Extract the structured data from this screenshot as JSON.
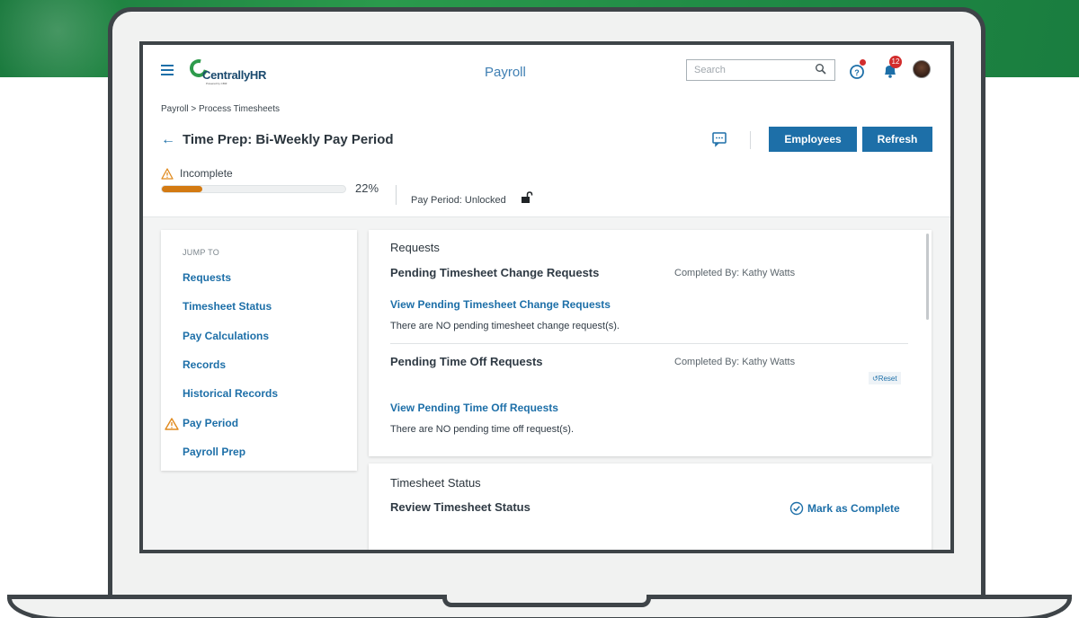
{
  "app": {
    "title": "Payroll",
    "logo_text": "CentrallyHR",
    "logo_subtext": "Powered by CBIZ"
  },
  "header": {
    "search_placeholder": "Search",
    "notification_count": "12"
  },
  "breadcrumb": "Payroll > Process Timesheets",
  "page_title": "Time Prep: Bi-Weekly Pay Period",
  "buttons": {
    "employees": "Employees",
    "refresh": "Refresh"
  },
  "status": {
    "label": "Incomplete",
    "progress_percent": 22,
    "progress_text": "22%",
    "pay_period": "Pay Period: Unlocked"
  },
  "jump_to": {
    "title": "JUMP TO",
    "items": [
      {
        "label": "Requests",
        "warning": false
      },
      {
        "label": "Timesheet Status",
        "warning": false
      },
      {
        "label": "Pay Calculations",
        "warning": false
      },
      {
        "label": "Records",
        "warning": false
      },
      {
        "label": "Historical Records",
        "warning": false
      },
      {
        "label": "Pay Period",
        "warning": true
      },
      {
        "label": "Payroll Prep",
        "warning": false
      }
    ]
  },
  "requests_card": {
    "title": "Requests",
    "timesheet_change": {
      "heading": "Pending Timesheet Change Requests",
      "completed_by": "Completed By: Kathy Watts",
      "link": "View Pending Timesheet Change Requests",
      "message": "There are NO pending timesheet change request(s)."
    },
    "time_off": {
      "heading": "Pending Time Off Requests",
      "completed_by": "Completed By: Kathy Watts",
      "reset": "↺Reset",
      "link": "View Pending Time Off Requests",
      "message": "There are NO pending time off request(s)."
    }
  },
  "timesheet_card": {
    "title": "Timesheet Status",
    "heading": "Review Timesheet Status",
    "action": "Mark as Complete"
  },
  "colors": {
    "accent": "#1d6fa8",
    "progress": "#d37a12",
    "warning": "#e08a1e",
    "badge": "#d22d2d",
    "brand_green": "#2e9b4c"
  }
}
